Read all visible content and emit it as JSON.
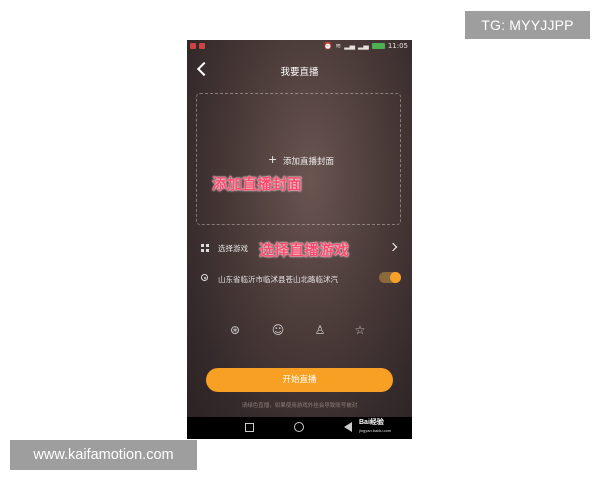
{
  "watermarks": {
    "top": "TG: MYYJJPP",
    "bottom": "www.kaifamotion.com"
  },
  "status_bar": {
    "time": "11:05",
    "icons": [
      "alarm-icon",
      "wifi-icon",
      "signal-icon",
      "signal-icon",
      "battery-icon"
    ]
  },
  "header": {
    "back_icon": "chevron-left-icon",
    "title": "我要直播"
  },
  "cover": {
    "plus": "+",
    "label": "添加直播封面",
    "annotation": "添加直播封面"
  },
  "game_row": {
    "icon": "grid-icon",
    "label": "选择游戏",
    "annotation": "选择直播游戏",
    "chevron": "chevron-right-icon"
  },
  "location_row": {
    "icon": "location-pin-icon",
    "label": "山东省临沂市临沭县苍山北路临沭汽",
    "toggle_on": true
  },
  "share_icons": [
    "moments-icon",
    "wechat-icon",
    "qq-icon",
    "qzone-star-icon"
  ],
  "start_button": "开始直播",
  "notice": "请绿色直播，如果使用游戏外挂会导致账号被封",
  "nav_bar": {
    "icons": [
      "square-recent-icon",
      "home-circle-icon",
      "back-triangle-icon"
    ],
    "baidu_logo": "Bai经验",
    "baidu_url": "jingyan.baidu.com"
  },
  "colors": {
    "accent": "#f7a023",
    "annotation": "#ff4a6e",
    "background": "#3a2e2e"
  }
}
